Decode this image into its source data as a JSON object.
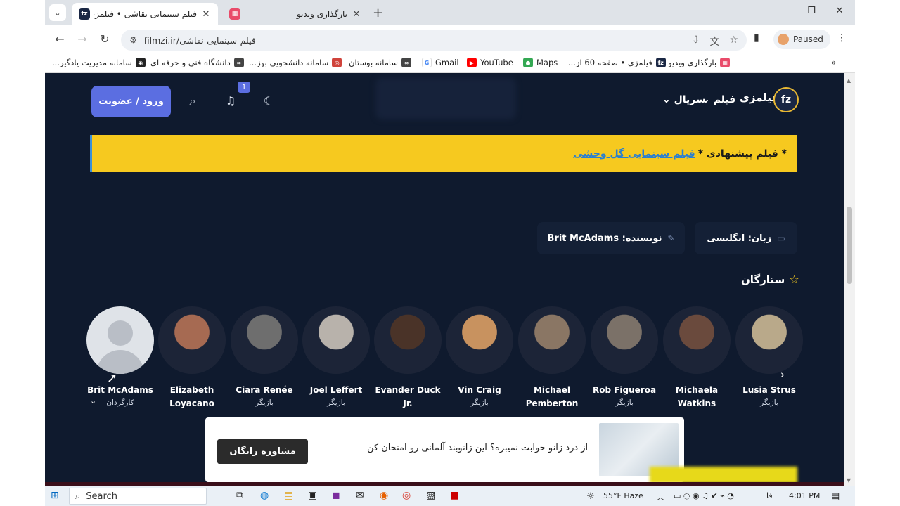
{
  "browser": {
    "tabs": [
      {
        "title": "فیلم سینمایی نقاشی • فیلمزی",
        "favicon": "fz",
        "active": true
      },
      {
        "title": "بارگذاری ویدیو",
        "favicon": "grid",
        "active": false
      }
    ],
    "url": "filmzi.ir/فیلم-سینمایی-نقاشی",
    "profile_status": "Paused",
    "bookmarks": [
      {
        "label": "بارگذاری ویدیو",
        "icon": "grid"
      },
      {
        "label": "فیلمزی • صفحه 60 از...",
        "icon": "fz"
      },
      {
        "label": "Maps",
        "icon": "maps"
      },
      {
        "label": "YouTube",
        "icon": "youtube"
      },
      {
        "label": "Gmail",
        "icon": "google"
      },
      {
        "label": "سامانه بوستان",
        "icon": "link"
      },
      {
        "label": "سامانه دانشجویی بهز...",
        "icon": "circle"
      },
      {
        "label": "دانشگاه فنی و حرفه ای",
        "icon": "link"
      },
      {
        "label": "سامانه مدیریت یادگیر...",
        "icon": "globe"
      }
    ]
  },
  "site": {
    "brand": "فیلمزی",
    "logo_text": "fz",
    "nav": {
      "film": "فیلم",
      "series": "سریال"
    },
    "login_button": "ورود / عضویت",
    "notification_count": "1",
    "promo": {
      "prefix": "* فیلم پیشنهادی *",
      "link": "فیلم سینمایی گل وحشی"
    },
    "info": {
      "language": "زبان: انگلیسی",
      "writer": "نویسنده: Brit McAdams"
    },
    "stars_title": "ستارگان",
    "cast": [
      {
        "name": "Lusia Strus",
        "role": "بازیگر",
        "tone": "#b9a98a"
      },
      {
        "name": "Michaela Watkins",
        "role": "",
        "tone": "#6a4a3d"
      },
      {
        "name": "Rob Figueroa",
        "role": "بازیگر",
        "tone": "#7b7168"
      },
      {
        "name": "Michael Pemberton",
        "role": "",
        "tone": "#8a7664"
      },
      {
        "name": "Vin Craig",
        "role": "بازیگر",
        "tone": "#c8925f"
      },
      {
        "name": "Evander Duck Jr.",
        "role": "",
        "tone": "#4a3328"
      },
      {
        "name": "Joel Leffert",
        "role": "بازیگر",
        "tone": "#b8b2ab"
      },
      {
        "name": "Ciara Renée",
        "role": "بازیگر",
        "tone": "#6e6e6e"
      },
      {
        "name": "Elizabeth Loyacano",
        "role": "",
        "tone": "#a66a52"
      },
      {
        "name": "Brit McAdams",
        "role": "کارگردان",
        "tone": "#d7dbe0"
      }
    ],
    "ad": {
      "text": "از درد زانو خوابت نمیبره؟ این زانوبند آلمانی رو امتحان کن",
      "button": "مشاوره رایگان"
    }
  },
  "taskbar": {
    "search_label": "Search",
    "weather": "55°F  Haze",
    "lang": "فا",
    "time": "4:01 PM"
  }
}
